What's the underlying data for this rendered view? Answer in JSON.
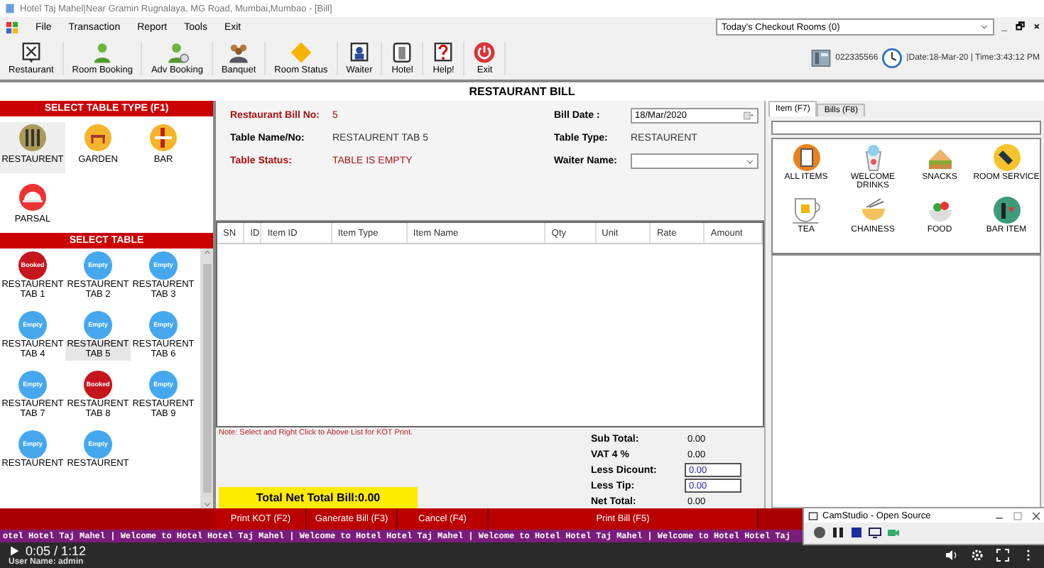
{
  "window": {
    "title": "Hotel Taj Mahel|Near Gramin Rugnalaya, MG Road, Mumbai,Mumbao - [Bill]"
  },
  "menu": [
    "File",
    "Transaction",
    "Report",
    "Tools",
    "Exit"
  ],
  "toolbar": [
    {
      "label": "Restaurant"
    },
    {
      "label": "Room Booking"
    },
    {
      "label": "Adv Booking"
    },
    {
      "label": "Banquet"
    },
    {
      "label": "Room Status"
    },
    {
      "label": "Waiter"
    },
    {
      "label": "Hotel"
    },
    {
      "label": "Help!"
    },
    {
      "label": "Exit"
    }
  ],
  "checkout_dropdown": {
    "value": "Today's Checkout Rooms (0)"
  },
  "mdi_controls": [
    "_",
    "🗗",
    "×"
  ],
  "phone": "022335566",
  "datetime": "|Date:18-Mar-20 | Time:3:43:12 PM",
  "heading": "RESTAURANT BILL",
  "left": {
    "types_title": "SELECT TABLE TYPE (F1)",
    "types": [
      {
        "label": "RESTAURENT",
        "selected": true
      },
      {
        "label": "GARDEN",
        "selected": false
      },
      {
        "label": "BAR",
        "selected": false
      },
      {
        "label": "PARSAL",
        "selected": false
      }
    ],
    "tables_title": "SELECT TABLE",
    "tables": [
      {
        "badge": "Booked",
        "kind": "booked",
        "name": "RESTAURENT TAB 1",
        "selected": false
      },
      {
        "badge": "Empty",
        "kind": "empty",
        "name": "RESTAURENT TAB 2",
        "selected": false
      },
      {
        "badge": "Empty",
        "kind": "empty",
        "name": "RESTAURENT TAB 3",
        "selected": false
      },
      {
        "badge": "Empty",
        "kind": "empty",
        "name": "RESTAURENT TAB 4",
        "selected": false
      },
      {
        "badge": "Empty",
        "kind": "empty",
        "name": "RESTAURENT TAB 5",
        "selected": true
      },
      {
        "badge": "Empty",
        "kind": "empty",
        "name": "RESTAURENT TAB 6",
        "selected": false
      },
      {
        "badge": "Empty",
        "kind": "empty",
        "name": "RESTAURENT TAB 7",
        "selected": false
      },
      {
        "badge": "Booked",
        "kind": "booked",
        "name": "RESTAURENT TAB 8",
        "selected": false
      },
      {
        "badge": "Empty",
        "kind": "empty",
        "name": "RESTAURENT TAB 9",
        "selected": false
      },
      {
        "badge": "Empty",
        "kind": "empty",
        "name": "RESTAURENT",
        "selected": false
      },
      {
        "badge": "Empty",
        "kind": "empty",
        "name": "RESTAURENT",
        "selected": false
      }
    ]
  },
  "bill": {
    "left_fields": [
      {
        "label": "Restaurant Bill No:",
        "value": "5",
        "alert": true
      },
      {
        "label": "Table Name/No:",
        "value": "RESTAURENT  TAB 5",
        "alert": false
      },
      {
        "label": "Table Status:",
        "value": "TABLE IS EMPTY",
        "alert": true
      }
    ],
    "right_fields": [
      {
        "label": "Bill Date :",
        "kind": "date",
        "value": "18/Mar/2020"
      },
      {
        "label": "Table Type:",
        "kind": "text",
        "value": "RESTAURENT"
      },
      {
        "label": "Waiter Name:",
        "kind": "select"
      }
    ],
    "columns": [
      "SN",
      "ID",
      "Item ID",
      "Item Type",
      "Item Name",
      "Qty",
      "Unit",
      "Rate",
      "Amount"
    ],
    "note": "Note: Select and Right Click to Above List for KOT Print.",
    "net_total": "Total Net Total Bill:0.00",
    "totals": [
      {
        "label": "Sub Total:",
        "value": "0.00",
        "kind": "text"
      },
      {
        "label": "VAT 4 %",
        "value": "0.00",
        "kind": "text"
      },
      {
        "label": "Less Dicount:",
        "value": "0.00",
        "kind": "input"
      },
      {
        "label": "Less Tip:",
        "value": "0.00",
        "kind": "input"
      },
      {
        "label": "Net Total:",
        "value": "0.00",
        "kind": "text"
      }
    ]
  },
  "actions": [
    "Print KOT (F2)",
    "Ganerate Bill (F3)",
    "Cancel (F4)",
    "Print Bill (F5)"
  ],
  "right": {
    "tabs": [
      {
        "label": "Item (F7)",
        "selected": true
      },
      {
        "label": "Bills (F8)",
        "selected": false
      }
    ],
    "categories": [
      {
        "label": "ALL ITEMS"
      },
      {
        "label": "WELCOME DRINKS"
      },
      {
        "label": "SNACKS"
      },
      {
        "label": "ROOM SERVICE"
      },
      {
        "label": "TEA"
      },
      {
        "label": "CHAINESS"
      },
      {
        "label": "FOOD"
      },
      {
        "label": "BAR ITEM"
      }
    ]
  },
  "marquee": "otel Hotel Taj Mahel |  Welcome to Hotel Hotel Taj Mahel |  Welcome to Hotel Hotel Taj Mahel |  Welcome to Hotel Hotel Taj Mahel |  Welcome to Hotel Hotel Taj",
  "user_name": "User Name: admin",
  "player": {
    "time": "0:05 / 1:12"
  },
  "camstudio": {
    "title": "CamStudio - Open Source"
  }
}
